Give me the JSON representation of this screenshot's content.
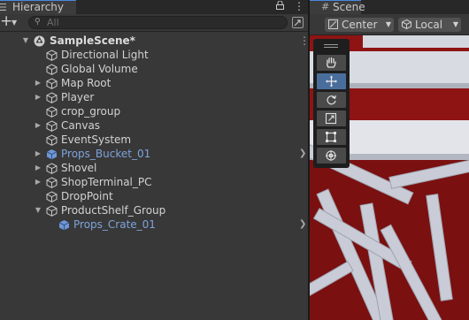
{
  "hierarchy": {
    "tab_label": "Hierarchy",
    "search_placeholder": "All",
    "scene_name": "SampleScene*",
    "items": [
      {
        "label": "Directional Light"
      },
      {
        "label": "Global Volume"
      },
      {
        "label": "Map Root"
      },
      {
        "label": "Player"
      },
      {
        "label": "crop_group"
      },
      {
        "label": "Canvas"
      },
      {
        "label": "EventSystem"
      },
      {
        "label": "Props_Bucket_01"
      },
      {
        "label": "Shovel"
      },
      {
        "label": "ShopTerminal_PC"
      },
      {
        "label": "DropPoint"
      },
      {
        "label": "ProductShelf_Group"
      },
      {
        "label": "Props_Crate_01"
      }
    ]
  },
  "scene": {
    "tab_label": "Scene",
    "pivot_mode": "Center",
    "pivot_rotation": "Local",
    "tools": [
      "hand-tool",
      "move-tool",
      "rotate-tool",
      "scale-tool",
      "rect-tool",
      "transform-tool"
    ],
    "selected_tool": "move-tool"
  },
  "colors": {
    "panel_bg": "#383838",
    "prefab_text": "#7ea3dc",
    "selected_tool": "#4a6e9c",
    "scene_background": "#8c1515",
    "tab_accent": "#4c88e0"
  }
}
